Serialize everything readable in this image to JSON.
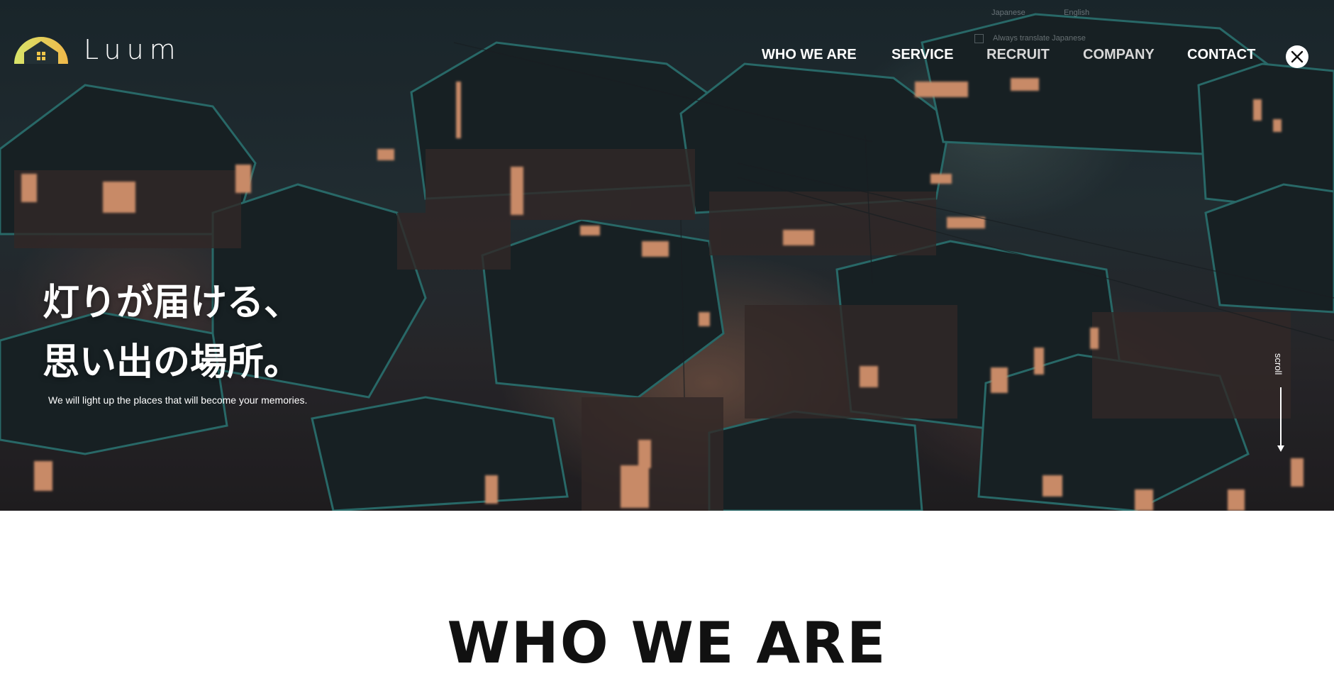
{
  "brand": {
    "name": "Luum",
    "logo_icon": "house-sunrise-icon"
  },
  "translate_widget": {
    "lang_source": "Japanese",
    "lang_target": "English",
    "checkbox_label": "Always translate Japanese"
  },
  "nav": {
    "items": [
      "WHO WE ARE",
      "SERVICE",
      "RECRUIT",
      "COMPANY",
      "CONTACT"
    ],
    "social_icon": "x-logo-icon"
  },
  "hero": {
    "headline_line1": "灯りが届ける、",
    "headline_line2": "思い出の場所。",
    "subline": "We will light up the places that will become your memories.",
    "scroll_label": "scroll"
  },
  "section": {
    "title": "WHO WE ARE"
  },
  "colors": {
    "logo_gradient_start": "#d8e56a",
    "logo_gradient_end": "#f0b84a",
    "heading_text": "#111111",
    "hero_window_light": "#f2a57a"
  }
}
